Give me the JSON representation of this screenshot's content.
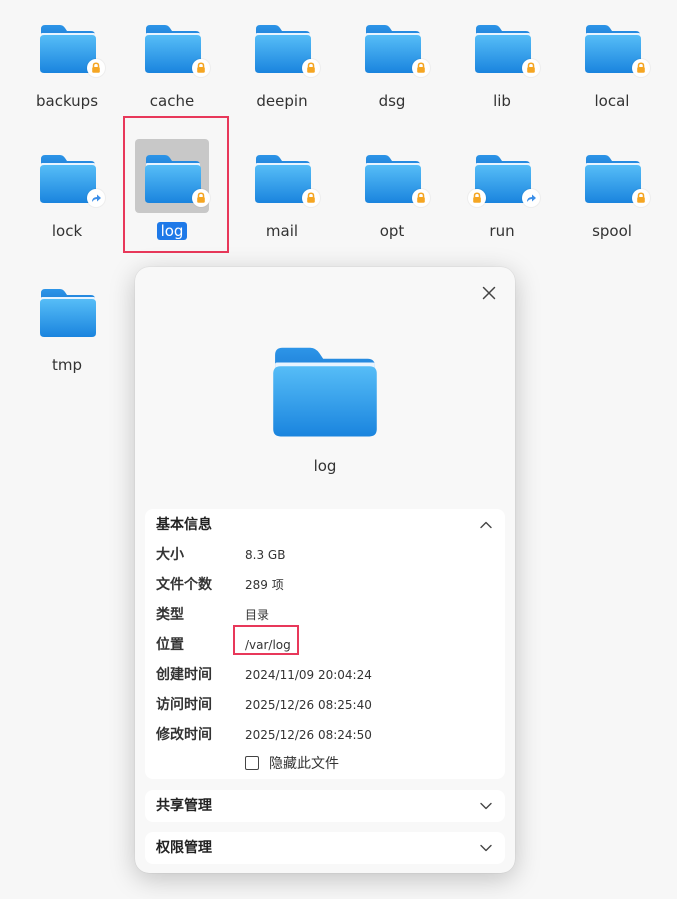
{
  "folders": [
    {
      "name": "backups",
      "badge": "lock"
    },
    {
      "name": "cache",
      "badge": "lock"
    },
    {
      "name": "deepin",
      "badge": "lock"
    },
    {
      "name": "dsg",
      "badge": "lock"
    },
    {
      "name": "lib",
      "badge": "lock"
    },
    {
      "name": "local",
      "badge": "lock"
    },
    {
      "name": "lock",
      "badge": "link"
    },
    {
      "name": "log",
      "badge": "lock",
      "selected": true
    },
    {
      "name": "mail",
      "badge": "lock"
    },
    {
      "name": "opt",
      "badge": "lock"
    },
    {
      "name": "run",
      "badge": "lock+link"
    },
    {
      "name": "spool",
      "badge": "lock"
    },
    {
      "name": "tmp",
      "badge": "none"
    }
  ],
  "dialog": {
    "name": "log",
    "basic": {
      "title": "基本信息",
      "size_label": "大小",
      "size_value": "8.3 GB",
      "count_label": "文件个数",
      "count_value": "289 项",
      "type_label": "类型",
      "type_value": "目录",
      "location_label": "位置",
      "location_value": "/var/log",
      "created_label": "创建时间",
      "created_value": "2024/11/09 20:04:24",
      "accessed_label": "访问时间",
      "accessed_value": "2025/12/26 08:25:40",
      "modified_label": "修改时间",
      "modified_value": "2025/12/26 08:24:50",
      "hide_label": "隐藏此文件"
    },
    "share_title": "共享管理",
    "permission_title": "权限管理"
  },
  "colors": {
    "folder_top": "#4fb6f5",
    "folder_bottom": "#1a86e0",
    "lock_badge": "#f5a623",
    "link_badge": "#3b8ee8",
    "selection": "#1e79e8",
    "highlight_box": "#e8385a"
  },
  "icons": {
    "close": "close-icon",
    "chevron_up": "chevron-up-icon",
    "chevron_down": "chevron-down-icon",
    "folder": "folder-icon",
    "lock": "lock-icon",
    "link": "link-arrow-icon"
  }
}
